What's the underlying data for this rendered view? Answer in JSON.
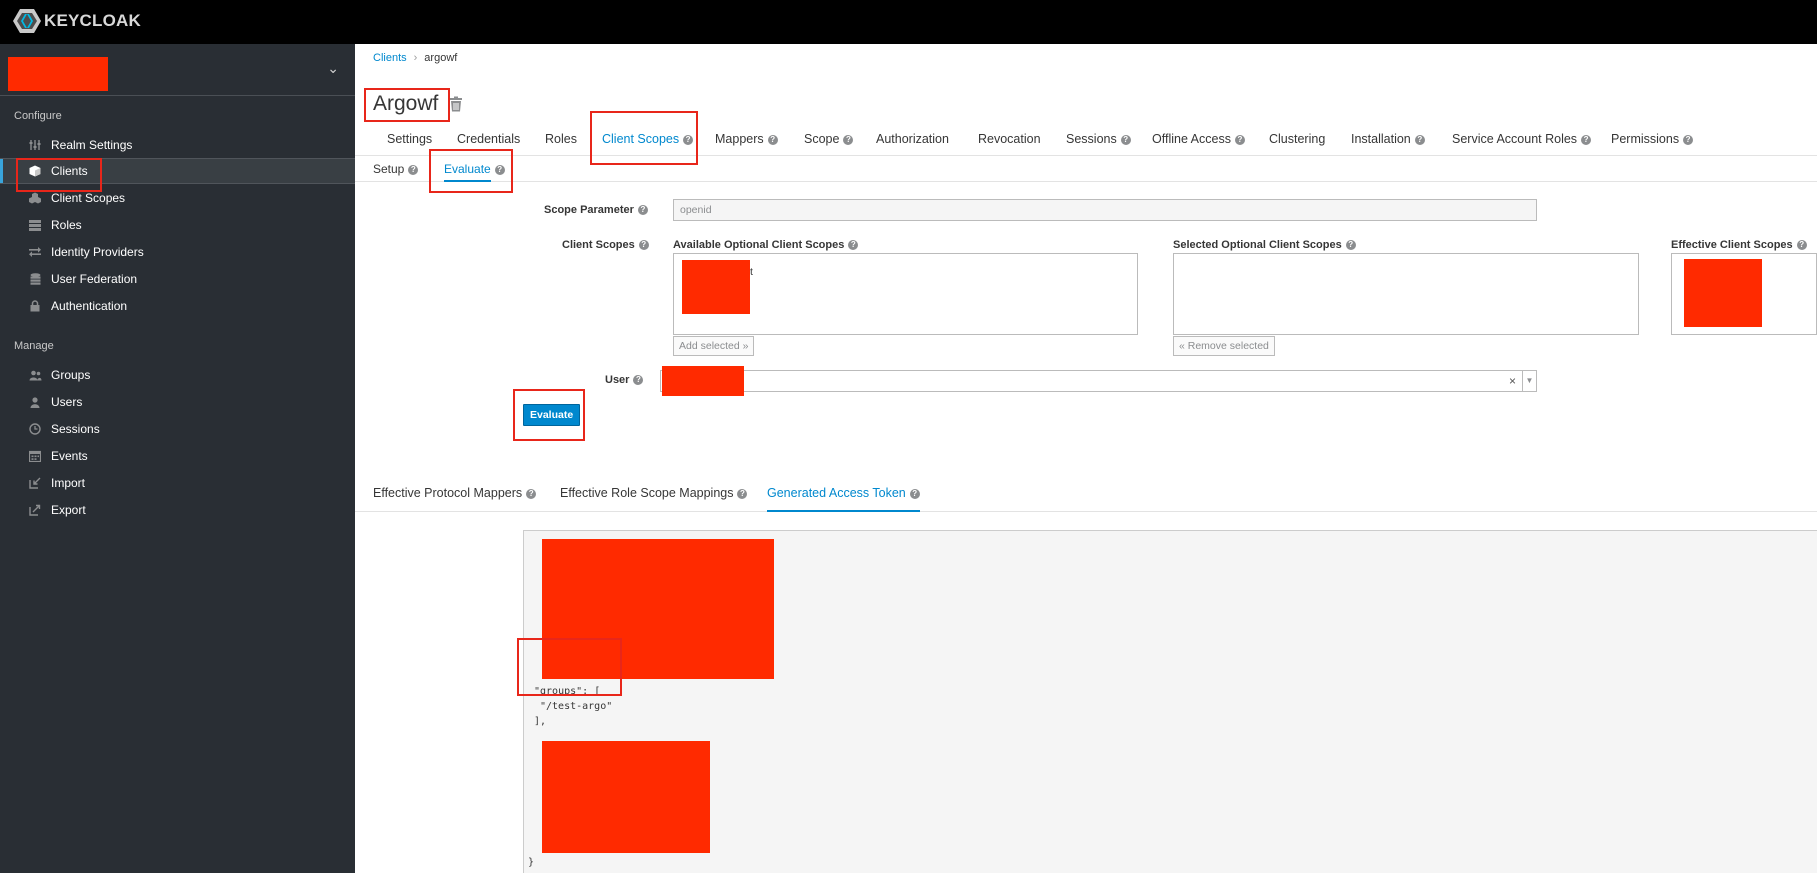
{
  "brand": {
    "name": "KEYCLOAK"
  },
  "sidebar": {
    "configure_label": "Configure",
    "manage_label": "Manage",
    "configure_items": [
      {
        "label": "Realm Settings",
        "icon": "sliders-icon"
      },
      {
        "label": "Clients",
        "icon": "cube-icon",
        "active": true
      },
      {
        "label": "Client Scopes",
        "icon": "cubes-icon"
      },
      {
        "label": "Roles",
        "icon": "list-icon"
      },
      {
        "label": "Identity Providers",
        "icon": "exchange-icon"
      },
      {
        "label": "User Federation",
        "icon": "database-icon"
      },
      {
        "label": "Authentication",
        "icon": "lock-icon"
      }
    ],
    "manage_items": [
      {
        "label": "Groups",
        "icon": "users-group-icon"
      },
      {
        "label": "Users",
        "icon": "user-icon"
      },
      {
        "label": "Sessions",
        "icon": "clock-icon"
      },
      {
        "label": "Events",
        "icon": "calendar-icon"
      },
      {
        "label": "Import",
        "icon": "import-icon"
      },
      {
        "label": "Export",
        "icon": "export-icon"
      }
    ]
  },
  "breadcrumb": {
    "parent": "Clients",
    "current": "argowf"
  },
  "client": {
    "title": "Argowf"
  },
  "tabs": [
    {
      "label": "Settings"
    },
    {
      "label": "Credentials"
    },
    {
      "label": "Roles"
    },
    {
      "label": "Client Scopes",
      "active": true
    },
    {
      "label": "Mappers"
    },
    {
      "label": "Scope"
    },
    {
      "label": "Authorization"
    },
    {
      "label": "Revocation"
    },
    {
      "label": "Sessions"
    },
    {
      "label": "Offline Access"
    },
    {
      "label": "Clustering"
    },
    {
      "label": "Installation"
    },
    {
      "label": "Service Account Roles"
    },
    {
      "label": "Permissions"
    }
  ],
  "subtabs": [
    {
      "label": "Setup"
    },
    {
      "label": "Evaluate",
      "active": true
    }
  ],
  "evaluate": {
    "scope_parameter_label": "Scope Parameter",
    "scope_parameter_value": "openid",
    "client_scopes_label": "Client Scopes",
    "available_label": "Available Optional Client Scopes",
    "selected_label": "Selected Optional Client Scopes",
    "effective_label": "Effective Client Scopes",
    "available_fragment": "t",
    "add_selected": "Add selected »",
    "remove_selected": "« Remove selected",
    "user_label": "User",
    "evaluate_button": "Evaluate"
  },
  "result_tabs": [
    {
      "label": "Effective Protocol Mappers"
    },
    {
      "label": "Effective Role Scope Mappings"
    },
    {
      "label": "Generated Access Token",
      "active": true
    }
  ],
  "token": {
    "groups_key": "\"groups\": [",
    "groups_value": "\"/test-argo\"",
    "groups_close": "],",
    "closing_brace": "}"
  },
  "colors": {
    "brand_blue": "#0088ce",
    "sidebar_bg": "#292e34",
    "annotation_red": "#e8261a",
    "redaction_red": "#ff2a00"
  }
}
